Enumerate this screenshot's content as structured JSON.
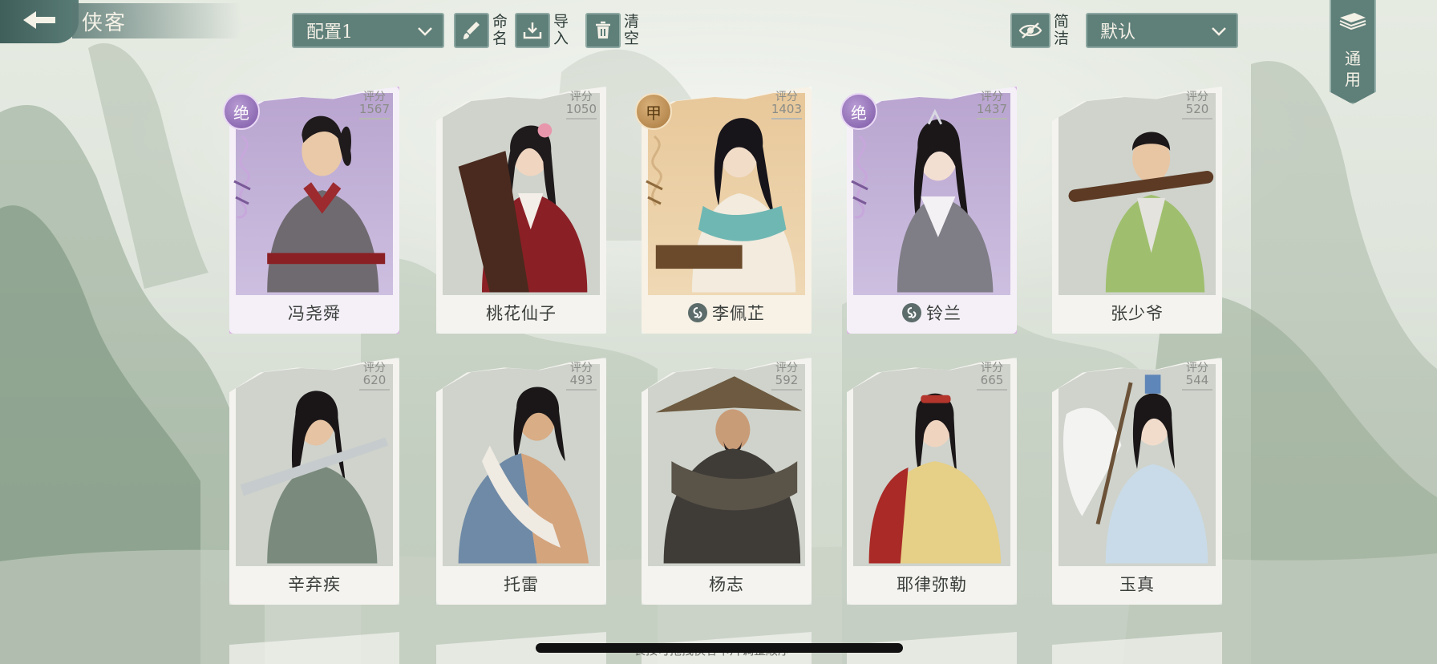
{
  "header": {
    "title": "侠客",
    "config_select": "配置1",
    "rename_label": "命名",
    "import_label": "导入",
    "clear_label": "清空",
    "simple_label": "简洁",
    "sort_select": "默认",
    "general_label": "通用"
  },
  "cards": [
    {
      "name": "冯尧舜",
      "score_label": "评分",
      "score": "1567",
      "rank": "绝",
      "style": "legend",
      "sect_icon": false
    },
    {
      "name": "桃花仙子",
      "score_label": "评分",
      "score": "1050",
      "rank": "",
      "style": "normal",
      "sect_icon": false
    },
    {
      "name": "李佩芷",
      "score_label": "评分",
      "score": "1403",
      "rank": "甲",
      "style": "gold",
      "sect_icon": true
    },
    {
      "name": "铃兰",
      "score_label": "评分",
      "score": "1437",
      "rank": "绝",
      "style": "legend",
      "sect_icon": true
    },
    {
      "name": "张少爷",
      "score_label": "评分",
      "score": "520",
      "rank": "",
      "style": "normal",
      "sect_icon": false
    },
    {
      "name": "辛弃疾",
      "score_label": "评分",
      "score": "620",
      "rank": "",
      "style": "normal",
      "sect_icon": false
    },
    {
      "name": "托雷",
      "score_label": "评分",
      "score": "493",
      "rank": "",
      "style": "normal",
      "sect_icon": false
    },
    {
      "name": "杨志",
      "score_label": "评分",
      "score": "592",
      "rank": "",
      "style": "normal",
      "sect_icon": false
    },
    {
      "name": "耶律弥勒",
      "score_label": "评分",
      "score": "665",
      "rank": "",
      "style": "normal",
      "sect_icon": false
    },
    {
      "name": "玉真",
      "score_label": "评分",
      "score": "544",
      "rank": "",
      "style": "normal",
      "sect_icon": false
    }
  ],
  "footer": {
    "hint": "长按可拖拽侠客卡片调整顺序"
  },
  "colors": {
    "accent": "#5f7f79",
    "legend_glow": "#d6aade",
    "gold_rank": "#a9793e"
  },
  "icons": [
    "back-arrow-icon",
    "chevron-down-icon",
    "brush-icon",
    "download-icon",
    "trash-icon",
    "eye-slash-icon",
    "book-icon",
    "sect-swirl-icon"
  ]
}
